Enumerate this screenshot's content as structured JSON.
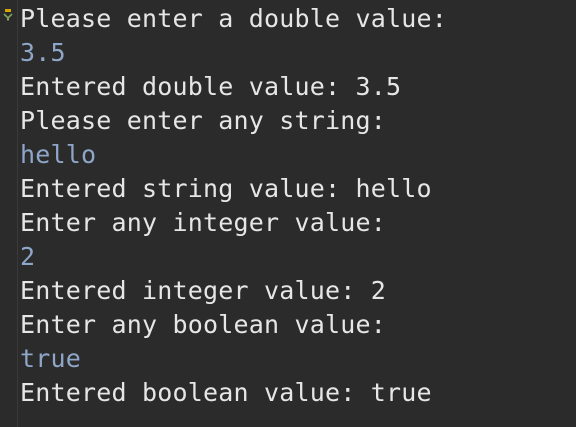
{
  "console": {
    "colors": {
      "background": "#2b2b2b",
      "output_text": "#e6e6e6",
      "input_text": "#8ea6c8"
    },
    "gutter_icon": "run-marker-icon",
    "lines": [
      {
        "kind": "output",
        "text": "Please enter a double value:"
      },
      {
        "kind": "input",
        "text": "3.5"
      },
      {
        "kind": "output",
        "text": "Entered double value: 3.5"
      },
      {
        "kind": "output",
        "text": "Please enter any string:"
      },
      {
        "kind": "input",
        "text": "hello"
      },
      {
        "kind": "output",
        "text": "Entered string value: hello"
      },
      {
        "kind": "output",
        "text": "Enter any integer value:"
      },
      {
        "kind": "input",
        "text": "2"
      },
      {
        "kind": "output",
        "text": "Entered integer value: 2"
      },
      {
        "kind": "output",
        "text": "Enter any boolean value:"
      },
      {
        "kind": "input",
        "text": "true"
      },
      {
        "kind": "output",
        "text": "Entered boolean value: true"
      }
    ]
  }
}
